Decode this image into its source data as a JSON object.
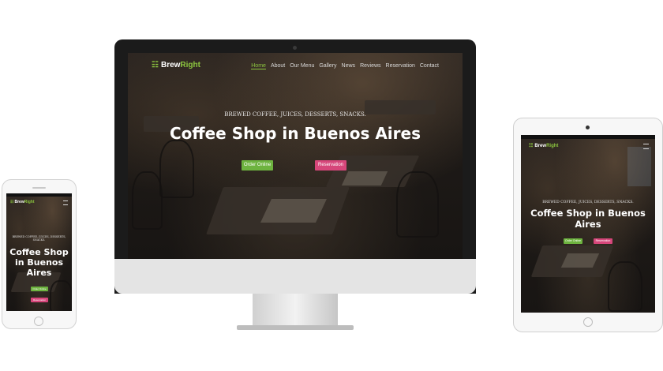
{
  "brand": {
    "name_part1": "Brew",
    "name_part2": "Right"
  },
  "nav": {
    "items": [
      "Home",
      "About",
      "Our Menu",
      "Gallery",
      "News",
      "Reviews",
      "Reservation",
      "Contact"
    ]
  },
  "hero": {
    "tagline": "BREWED COFFEE, JUICES, DESSERTS, SNACKS.",
    "title": "Coffee Shop in Buenos Aires",
    "order_label": "Order Online",
    "reservation_label": "Reservation"
  },
  "tablet_title": {
    "line1": "Coffee Shop in Buenos",
    "line2": "Aires"
  },
  "phone_title": {
    "line1": "Coffee Shop",
    "line2": "in Buenos",
    "line3": "Aires"
  },
  "colors": {
    "accent_green": "#6db33f",
    "accent_pink": "#d6467a",
    "logo_green": "#8cc63f"
  }
}
